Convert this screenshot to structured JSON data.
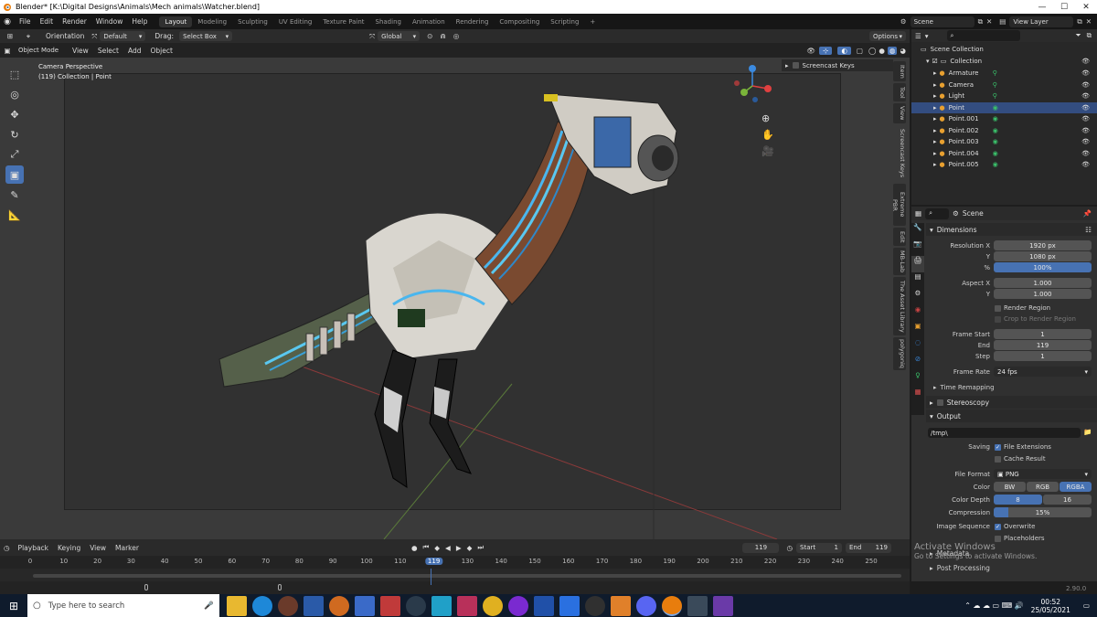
{
  "window": {
    "title": "Blender* [K:\\Digital Designs\\Animals\\Mech animals\\Watcher.blend]",
    "min": "—",
    "max": "☐",
    "close": "✕"
  },
  "topbar": {
    "menus": [
      "File",
      "Edit",
      "Render",
      "Window",
      "Help"
    ],
    "workspaces": [
      "Layout",
      "Modeling",
      "Sculpting",
      "UV Editing",
      "Texture Paint",
      "Shading",
      "Animation",
      "Rendering",
      "Compositing",
      "Scripting"
    ],
    "add_tab": "+",
    "scene": "Scene",
    "view_layer": "View Layer"
  },
  "viewport_header": {
    "orientation_label": "Orientation",
    "orientation_value": "Default",
    "drag_label": "Drag:",
    "drag_value": "Select Box",
    "transform": "Global",
    "options": "Options"
  },
  "viewport_menu": {
    "mode": "Object Mode",
    "items": [
      "View",
      "Select",
      "Add",
      "Object"
    ]
  },
  "viewport": {
    "perspective": "Camera Perspective",
    "collection": "(119) Collection | Point",
    "screencast": "Screencast Keys"
  },
  "side_tabs": [
    "Item",
    "Tool",
    "View",
    "Screencast Keys",
    "Extreme PBR",
    "Edit",
    "MB-Lab",
    "The Asset Library",
    "polygoniq"
  ],
  "outliner": {
    "root": "Scene Collection",
    "collection": "Collection",
    "items": [
      "Armature",
      "Camera",
      "Light",
      "Point",
      "Point.001",
      "Point.002",
      "Point.003",
      "Point.004",
      "Point.005"
    ]
  },
  "properties": {
    "context": "Scene",
    "dimensions": {
      "header": "Dimensions",
      "res_x_label": "Resolution X",
      "res_x": "1920 px",
      "res_y_label": "Y",
      "res_y": "1080 px",
      "pct_label": "%",
      "pct": "100%",
      "aspect_x_label": "Aspect X",
      "aspect_x": "1.000",
      "aspect_y_label": "Y",
      "aspect_y": "1.000",
      "render_region": "Render Region",
      "crop_region": "Crop to Render Region",
      "frame_start_label": "Frame Start",
      "frame_start": "1",
      "end_label": "End",
      "end": "119",
      "step_label": "Step",
      "step": "1",
      "frame_rate_label": "Frame Rate",
      "frame_rate": "24 fps",
      "time_remapping": "Time Remapping"
    },
    "stereoscopy": "Stereoscopy",
    "output": {
      "header": "Output",
      "path": "/tmp\\",
      "saving_label": "Saving",
      "file_ext": "File Extensions",
      "cache_result": "Cache Result",
      "file_format_label": "File Format",
      "file_format": "PNG",
      "color_label": "Color",
      "color_opts": [
        "BW",
        "RGB",
        "RGBA"
      ],
      "depth_label": "Color Depth",
      "depth_opts": [
        "8",
        "16"
      ],
      "compression_label": "Compression",
      "compression": "15%",
      "compression_fraction": 0.15,
      "img_seq_label": "Image Sequence",
      "overwrite": "Overwrite",
      "placeholders": "Placeholders"
    },
    "metadata": "Metadata",
    "post_processing": "Post Processing"
  },
  "watermark": {
    "line1": "Activate Windows",
    "line2": "Go to Settings to activate Windows."
  },
  "timeline": {
    "menus": [
      "Playback",
      "Keying",
      "View",
      "Marker"
    ],
    "current_frame": "119",
    "start_label": "Start",
    "start": "1",
    "end_label": "End",
    "end": "119",
    "ticks": [
      "0",
      "10",
      "20",
      "30",
      "40",
      "50",
      "60",
      "70",
      "80",
      "90",
      "100",
      "110",
      "119",
      "130",
      "140",
      "150",
      "160",
      "170",
      "180",
      "190",
      "200",
      "210",
      "220",
      "230",
      "240",
      "250"
    ],
    "version": "2.90.0"
  },
  "taskbar": {
    "search_placeholder": "Type here to search",
    "time": "00:52",
    "date": "25/05/2021"
  },
  "colors": {
    "accent": "#4772b3",
    "frame": "#4772b3"
  }
}
